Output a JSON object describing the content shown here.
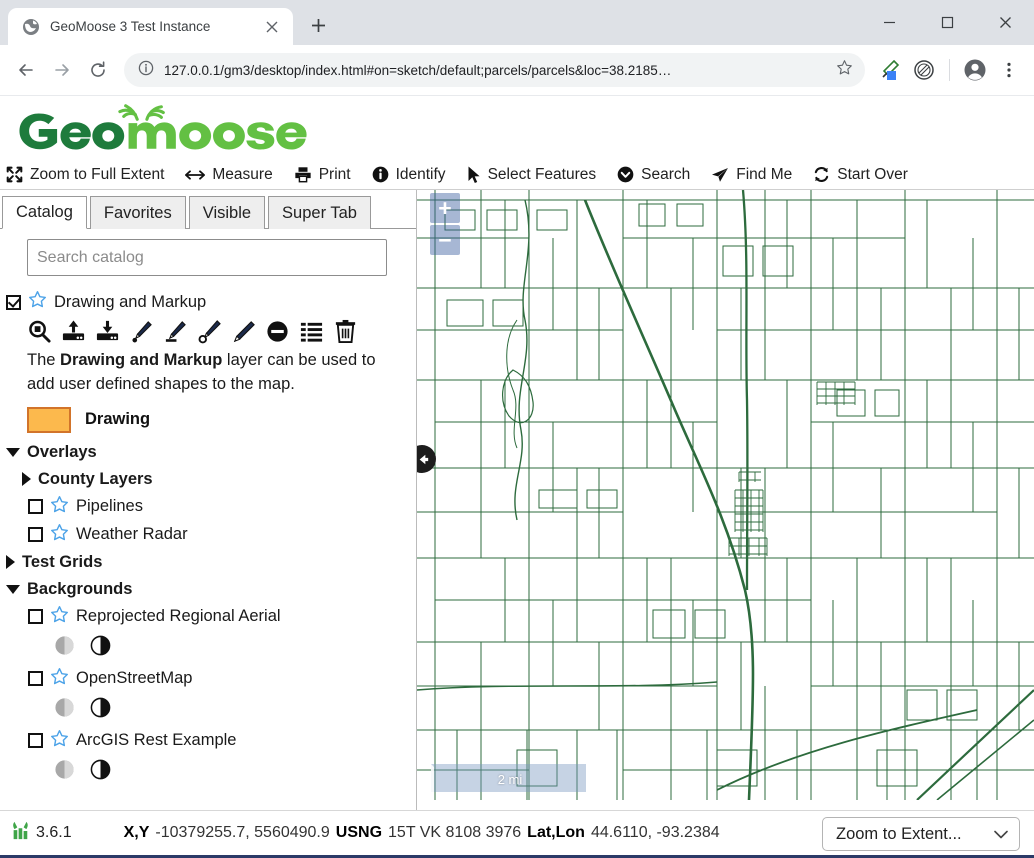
{
  "browser": {
    "tab": {
      "title": "GeoMoose 3 Test Instance",
      "favicon": "globe-icon",
      "close": "×"
    },
    "new_tab_label": "+",
    "window_controls": {
      "minimize": "—",
      "maximize": "□",
      "close": "✕"
    },
    "nav": {
      "back": "←",
      "forward": "→",
      "reload": "⟳"
    },
    "omnibox": {
      "url": "127.0.0.1/gm3/desktop/index.html#on=sketch/default;parcels/parcels&loc=38.2185…",
      "info_icon": "info-circle-icon",
      "bookmark_icon": "star-outline-icon"
    },
    "extensions": [
      "eyedropper-icon",
      "stamp-icon"
    ],
    "profile_icon": "account-avatar-icon",
    "menu_icon": "three-dot-menu-icon"
  },
  "app": {
    "logo_text": "GeoMoose",
    "logo_colors": {
      "geo": "#1e7b3c",
      "moose": "#63c043"
    },
    "toolbar": [
      {
        "label": "Zoom to Full Extent",
        "icon": "expand-arrows-icon"
      },
      {
        "label": "Measure",
        "icon": "double-arrow-icon"
      },
      {
        "label": "Print",
        "icon": "printer-icon"
      },
      {
        "label": "Identify",
        "icon": "info-circle-icon"
      },
      {
        "label": "Select Features",
        "icon": "cursor-arrow-icon"
      },
      {
        "label": "Search",
        "icon": "chevron-circle-icon"
      },
      {
        "label": "Find Me",
        "icon": "paper-plane-icon"
      },
      {
        "label": "Start Over",
        "icon": "refresh-icon"
      }
    ]
  },
  "sidebar": {
    "tabs": [
      {
        "label": "Catalog",
        "active": true
      },
      {
        "label": "Favorites",
        "active": false
      },
      {
        "label": "Visible",
        "active": false
      },
      {
        "label": "Super Tab",
        "active": false
      }
    ],
    "search": {
      "placeholder": "Search catalog",
      "value": ""
    },
    "drawing_layer": {
      "label": "Drawing and Markup",
      "checked": true,
      "star": "star-outline-icon",
      "tools": [
        "zoom-to-layer-icon",
        "upload-icon",
        "download-icon",
        "draw-point-icon",
        "draw-line-icon",
        "draw-polygon-icon",
        "modify-icon",
        "remove-icon",
        "attributes-list-icon",
        "trash-icon"
      ],
      "description_pre": "The ",
      "description_bold": "Drawing and Markup",
      "description_post": " layer can be used to add user defined shapes to the map.",
      "legend": {
        "label": "Drawing",
        "fill": "#fcb94d",
        "stroke": "#d2742a"
      }
    },
    "groups": [
      {
        "label": "Overlays",
        "expanded": true,
        "children": [
          {
            "label": "County Layers",
            "type": "group",
            "expanded": false
          },
          {
            "label": "Pipelines",
            "type": "layer",
            "checked": false,
            "star": "star-outline-icon"
          },
          {
            "label": "Weather Radar",
            "type": "layer",
            "checked": false,
            "star": "star-outline-icon"
          }
        ]
      },
      {
        "label": "Test Grids",
        "expanded": false,
        "children": []
      },
      {
        "label": "Backgrounds",
        "expanded": true,
        "children": [
          {
            "label": "Reprojected Regional Aerial",
            "type": "layer",
            "checked": false,
            "star": "star-outline-icon",
            "opacity_icons": [
              "fade-down-icon",
              "fade-up-icon"
            ]
          },
          {
            "label": "OpenStreetMap",
            "type": "layer",
            "checked": false,
            "star": "star-outline-icon",
            "opacity_icons": [
              "fade-down-icon",
              "fade-up-icon"
            ]
          },
          {
            "label": "ArcGIS Rest Example",
            "type": "layer",
            "checked": false,
            "star": "star-outline-icon",
            "opacity_icons": [
              "fade-down-icon",
              "fade-up-icon"
            ]
          }
        ]
      }
    ]
  },
  "map": {
    "zoom_in_label": "+",
    "zoom_out_label": "−",
    "collapse_icon": "arrow-left-circle-icon",
    "scale_label": "2 mi",
    "line_color": "#2d6b3d"
  },
  "status": {
    "version_icon": "geomoose-mark-icon",
    "version": "3.6.1",
    "xy_label": "X,Y",
    "xy_value": "-10379255.7, 5560490.9",
    "usng_label": "USNG",
    "usng_value": "15T VK 8108 3976",
    "latlon_label": "Lat,Lon",
    "latlon_value": "44.6110, -93.2384",
    "extent_select": {
      "value": "Zoom to Extent...",
      "chevron": "chevron-down-icon"
    }
  }
}
